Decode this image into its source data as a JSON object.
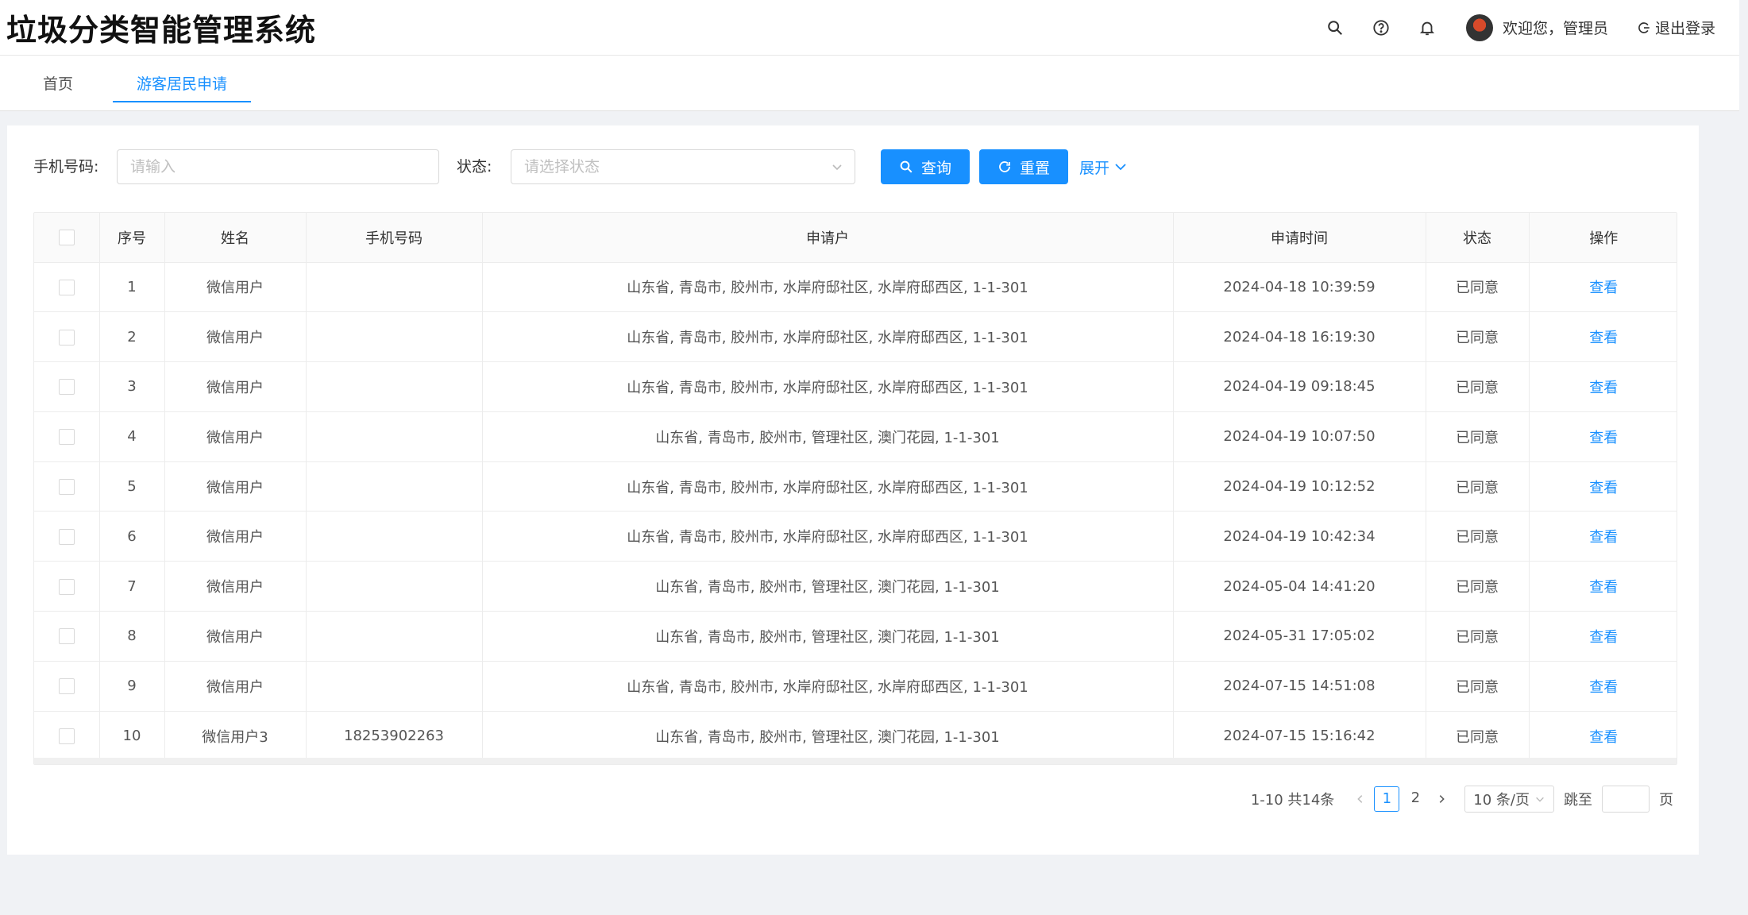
{
  "app": {
    "title": "垃圾分类智能管理系统"
  },
  "header": {
    "icons": [
      "search-icon",
      "help-icon",
      "bell-icon"
    ],
    "user_label": "欢迎您，管理员",
    "logout_label": "退出登录"
  },
  "tabs": [
    {
      "label": "首页",
      "active": false
    },
    {
      "label": "游客居民申请",
      "active": true
    }
  ],
  "filters": {
    "phone_label": "手机号码:",
    "phone_placeholder": "请输入",
    "status_label": "状态:",
    "status_placeholder": "请选择状态",
    "query_label": "查询",
    "reset_label": "重置",
    "expand_label": "展开"
  },
  "table": {
    "columns": [
      "序号",
      "姓名",
      "手机号码",
      "申请户",
      "申请时间",
      "状态",
      "操作"
    ],
    "rows": [
      {
        "index": "1",
        "name": "微信用户",
        "phone": "",
        "household": "山东省, 青岛市, 胶州市, 水岸府邸社区, 水岸府邸西区, 1-1-301",
        "time": "2024-04-18 10:39:59",
        "status": "已同意",
        "action": "查看"
      },
      {
        "index": "2",
        "name": "微信用户",
        "phone": "",
        "household": "山东省, 青岛市, 胶州市, 水岸府邸社区, 水岸府邸西区, 1-1-301",
        "time": "2024-04-18 16:19:30",
        "status": "已同意",
        "action": "查看"
      },
      {
        "index": "3",
        "name": "微信用户",
        "phone": "",
        "household": "山东省, 青岛市, 胶州市, 水岸府邸社区, 水岸府邸西区, 1-1-301",
        "time": "2024-04-19 09:18:45",
        "status": "已同意",
        "action": "查看"
      },
      {
        "index": "4",
        "name": "微信用户",
        "phone": "",
        "household": "山东省, 青岛市, 胶州市, 管理社区, 澳门花园, 1-1-301",
        "time": "2024-04-19 10:07:50",
        "status": "已同意",
        "action": "查看"
      },
      {
        "index": "5",
        "name": "微信用户",
        "phone": "",
        "household": "山东省, 青岛市, 胶州市, 水岸府邸社区, 水岸府邸西区, 1-1-301",
        "time": "2024-04-19 10:12:52",
        "status": "已同意",
        "action": "查看"
      },
      {
        "index": "6",
        "name": "微信用户",
        "phone": "",
        "household": "山东省, 青岛市, 胶州市, 水岸府邸社区, 水岸府邸西区, 1-1-301",
        "time": "2024-04-19 10:42:34",
        "status": "已同意",
        "action": "查看"
      },
      {
        "index": "7",
        "name": "微信用户",
        "phone": "",
        "household": "山东省, 青岛市, 胶州市, 管理社区, 澳门花园, 1-1-301",
        "time": "2024-05-04 14:41:20",
        "status": "已同意",
        "action": "查看"
      },
      {
        "index": "8",
        "name": "微信用户",
        "phone": "",
        "household": "山东省, 青岛市, 胶州市, 管理社区, 澳门花园, 1-1-301",
        "time": "2024-05-31 17:05:02",
        "status": "已同意",
        "action": "查看"
      },
      {
        "index": "9",
        "name": "微信用户",
        "phone": "",
        "household": "山东省, 青岛市, 胶州市, 水岸府邸社区, 水岸府邸西区, 1-1-301",
        "time": "2024-07-15 14:51:08",
        "status": "已同意",
        "action": "查看"
      },
      {
        "index": "10",
        "name": "微信用户3",
        "phone": "18253902263",
        "household": "山东省, 青岛市, 胶州市, 管理社区, 澳门花园, 1-1-301",
        "time": "2024-07-15 15:16:42",
        "status": "已同意",
        "action": "查看"
      }
    ]
  },
  "pagination": {
    "total_label": "1-10 共14条",
    "pages": [
      "1",
      "2"
    ],
    "current_page": "1",
    "page_size_label": "10 条/页",
    "jump_label": "跳至",
    "page_suffix": "页"
  },
  "colors": {
    "accent": "#1890ff",
    "header_bg": "#ffffff",
    "page_bg": "#f0f2f5"
  }
}
